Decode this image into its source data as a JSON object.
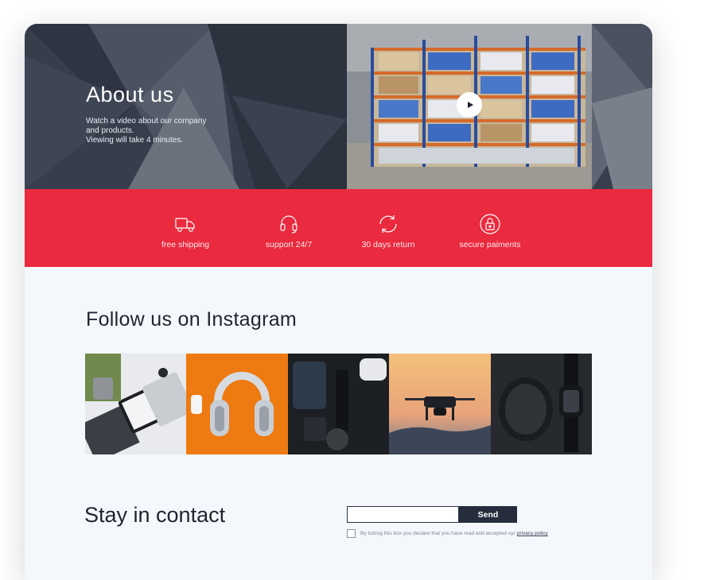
{
  "about": {
    "title": "About us",
    "description_lines": [
      "Watch a video about our company",
      "and products.",
      "Viewing will take 4 minutes."
    ]
  },
  "video": {
    "play_icon": "play-icon"
  },
  "features": [
    {
      "label": "free shipping",
      "icon": "truck-icon"
    },
    {
      "label": "support 24/7",
      "icon": "headset-icon"
    },
    {
      "label": "30 days return",
      "icon": "refresh-icon"
    },
    {
      "label": "secure paiments",
      "icon": "lock-icon"
    }
  ],
  "instagram": {
    "title": "Follow us on Instagram",
    "photos": [
      "workspace-photo",
      "headphones-photo",
      "gadgets-photo",
      "drone-photo",
      "smartwatch-photo"
    ]
  },
  "contact": {
    "title": "Stay in contact",
    "email_value": "",
    "send_label": "Send",
    "consent_text": "By ticking this box you declare that you have read and accepted oyr",
    "privacy_link": "privacy policy"
  },
  "colors": {
    "hero_bg": "#363d4b",
    "accent_red": "#ea2a3e",
    "button_dark": "#252d3d",
    "page_bg": "#f4f8fd"
  }
}
